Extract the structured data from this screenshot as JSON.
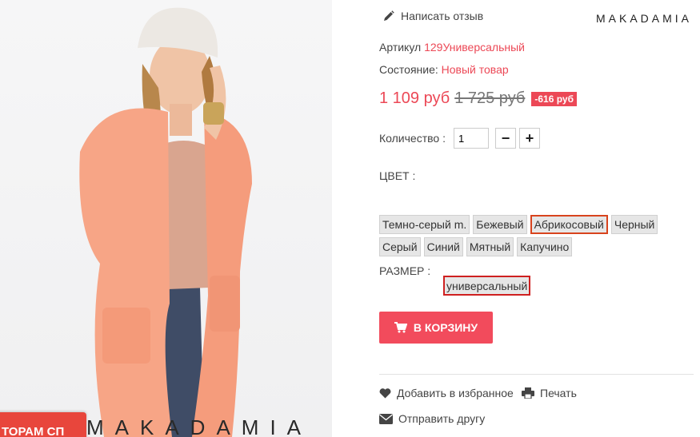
{
  "photo": {
    "watermark": "MAKADAMIA",
    "promo_ribbon": "ТОРАМ СП"
  },
  "panel": {
    "brand": "MAKADAMIA",
    "review_link": "Написать отзыв",
    "sku_label": "Артикул",
    "sku_value": "129Универсальный",
    "condition_label": "Состояние:",
    "condition_value": "Новый товар",
    "price_new": "1 109 руб",
    "price_old": "1 725 руб",
    "discount": "-616 руб",
    "quantity_label": "Количество :",
    "quantity_value": "1",
    "minus_label": "−",
    "plus_label": "+",
    "color_label": "ЦВЕТ :",
    "colors_row1": [
      "Темно-серый m.",
      "Бежевый",
      "Абрикосовый",
      "Черный"
    ],
    "colors_row2": [
      "Серый",
      "Синий",
      "Мятный",
      "Капучино"
    ],
    "selected_color": "Абрикосовый",
    "size_label": "РАЗМЕР :",
    "size_value": "универсальный",
    "cart_button": "В КОРЗИНУ",
    "favorite": "Добавить в избранное",
    "print": "Печать",
    "send_friend": "Отправить другу"
  },
  "icons": {
    "review": "pencil-icon",
    "cart": "cart-icon",
    "favorite": "heart-icon",
    "print": "printer-icon",
    "send": "envelope-icon"
  },
  "colors": {
    "accent": "#ec4856",
    "cart_button": "#f24b5c",
    "selected_chip_border": "#d8431d",
    "size_chip_border": "#cf2020"
  }
}
